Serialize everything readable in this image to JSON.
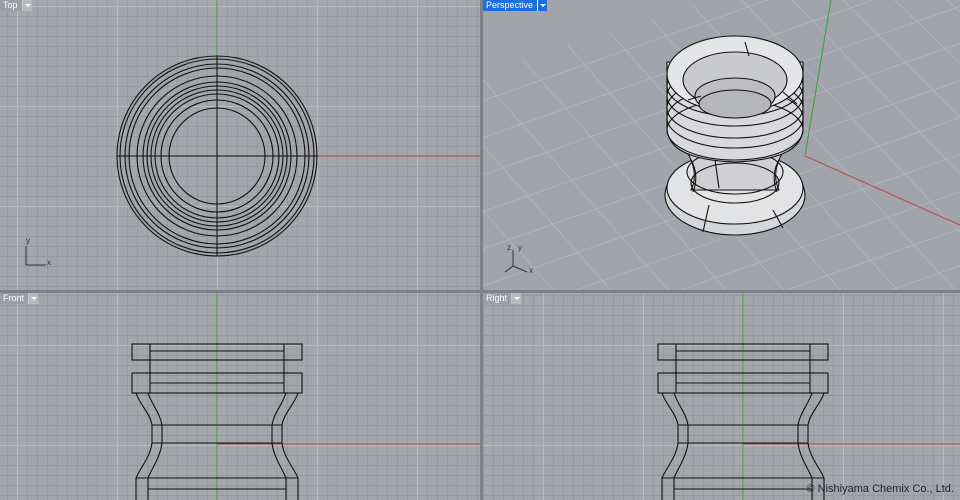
{
  "viewports": {
    "top": {
      "label": "Top"
    },
    "perspective": {
      "label": "Perspective"
    },
    "front": {
      "label": "Front"
    },
    "right": {
      "label": "Right"
    }
  },
  "axes": {
    "x": "x",
    "y": "y",
    "z": "z"
  },
  "copyright": "© Nishiyama Chemix Co., Ltd.",
  "colors": {
    "x_axis": "#b84a4a",
    "y_axis": "#2fa23a",
    "z_axis": "#2fa23a",
    "active_tab": "#1b6fe3",
    "model_line": "#111111",
    "model_fill": "#d3d4d7"
  },
  "icons": {
    "viewport_menu": "dropdown-arrow-icon",
    "world_axes": "world-axes-icon"
  }
}
